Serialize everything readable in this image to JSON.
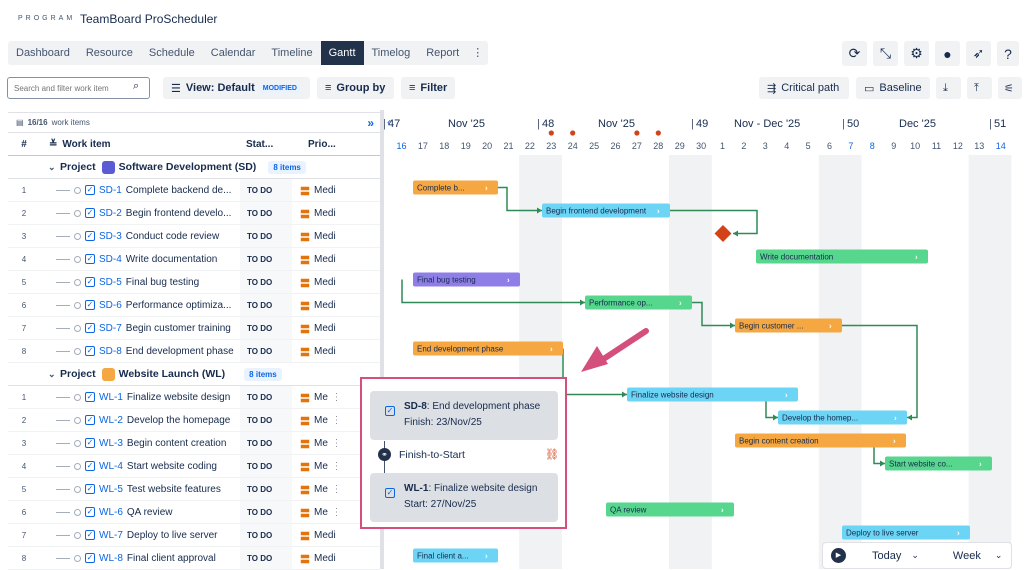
{
  "header": {
    "program_label": "PROGRAM",
    "app_title": "TeamBoard ProScheduler"
  },
  "tabs": [
    {
      "label": "Dashboard"
    },
    {
      "label": "Resource"
    },
    {
      "label": "Schedule"
    },
    {
      "label": "Calendar"
    },
    {
      "label": "Timeline"
    },
    {
      "label": "Gantt"
    },
    {
      "label": "Timelog"
    },
    {
      "label": "Report"
    }
  ],
  "tab_more": "⋮",
  "toolbar": {
    "search_placeholder": "Search and filter work item",
    "view_label": "View: Default",
    "modified": "MODIFIED",
    "group_by": "Group by",
    "filter": "Filter",
    "critical_path": "Critical path",
    "baseline": "Baseline"
  },
  "table": {
    "count": "16/16",
    "count_label": "work items",
    "col_num": "#",
    "col_item": "Work item",
    "col_status": "Stat...",
    "col_prio": "Prio...",
    "expand_glyph": "»"
  },
  "projects": [
    {
      "label": "Project",
      "name": "Software Development (SD)",
      "badge": "8 items",
      "items": [
        {
          "num": "1",
          "key": "SD-1",
          "title": "Complete backend de...",
          "status": "TO DO",
          "prio": "Medi"
        },
        {
          "num": "2",
          "key": "SD-2",
          "title": "Begin frontend develo...",
          "status": "TO DO",
          "prio": "Medi"
        },
        {
          "num": "3",
          "key": "SD-3",
          "title": "Conduct code review",
          "status": "TO DO",
          "prio": "Medi"
        },
        {
          "num": "4",
          "key": "SD-4",
          "title": "Write documentation",
          "status": "TO DO",
          "prio": "Medi"
        },
        {
          "num": "5",
          "key": "SD-5",
          "title": "Final bug testing",
          "status": "TO DO",
          "prio": "Medi"
        },
        {
          "num": "6",
          "key": "SD-6",
          "title": "Performance optimiza...",
          "status": "TO DO",
          "prio": "Medi"
        },
        {
          "num": "7",
          "key": "SD-7",
          "title": "Begin customer training",
          "status": "TO DO",
          "prio": "Medi"
        },
        {
          "num": "8",
          "key": "SD-8",
          "title": "End development phase",
          "status": "TO DO",
          "prio": "Medi"
        }
      ]
    },
    {
      "label": "Project",
      "name": "Website Launch (WL)",
      "badge": "8 items",
      "items": [
        {
          "num": "1",
          "key": "WL-1",
          "title": "Finalize website design",
          "status": "TO DO",
          "prio": "Me"
        },
        {
          "num": "2",
          "key": "WL-2",
          "title": "Develop the homepage",
          "status": "TO DO",
          "prio": "Me"
        },
        {
          "num": "3",
          "key": "WL-3",
          "title": "Begin content creation",
          "status": "TO DO",
          "prio": "Me"
        },
        {
          "num": "4",
          "key": "WL-4",
          "title": "Start website coding",
          "status": "TO DO",
          "prio": "Me"
        },
        {
          "num": "5",
          "key": "WL-5",
          "title": "Test website features",
          "status": "TO DO",
          "prio": "Me"
        },
        {
          "num": "6",
          "key": "WL-6",
          "title": "QA review",
          "status": "TO DO",
          "prio": "Me"
        },
        {
          "num": "7",
          "key": "WL-7",
          "title": "Deploy to live server",
          "status": "TO DO",
          "prio": "Medi"
        },
        {
          "num": "8",
          "key": "WL-8",
          "title": "Final client approval",
          "status": "TO DO",
          "prio": "Medi"
        }
      ]
    }
  ],
  "timeline": {
    "weeks": [
      {
        "label": "47"
      },
      {
        "label": "Nov '25"
      },
      {
        "label": "48"
      },
      {
        "label": "Nov '25"
      },
      {
        "label": "49"
      },
      {
        "label": "Nov - Dec '25"
      },
      {
        "label": "50"
      },
      {
        "label": "Dec '25"
      },
      {
        "label": "51"
      }
    ],
    "days": [
      "16",
      "17",
      "18",
      "19",
      "20",
      "21",
      "22",
      "23",
      "24",
      "25",
      "26",
      "27",
      "28",
      "29",
      "30",
      "1",
      "2",
      "3",
      "4",
      "5",
      "6",
      "7",
      "8",
      "9",
      "10",
      "11",
      "12",
      "13",
      "14"
    ],
    "back_glyph": "‹"
  },
  "bars": [
    {
      "label": "Complete b...",
      "color": "#f5a742"
    },
    {
      "label": "Begin frontend development",
      "color": "#6cd4f5"
    },
    {
      "label": "Write documentation",
      "color": "#57d68d"
    },
    {
      "label": "Final bug testing",
      "color": "#8f7ee7"
    },
    {
      "label": "Performance op...",
      "color": "#57d68d"
    },
    {
      "label": "Begin customer ...",
      "color": "#f5a742"
    },
    {
      "label": "End development phase",
      "color": "#f5a742"
    },
    {
      "label": "Finalize website design",
      "color": "#6cd4f5"
    },
    {
      "label": "Develop the homep...",
      "color": "#6cd4f5"
    },
    {
      "label": "Begin content creation",
      "color": "#f5a742"
    },
    {
      "label": "Start website co...",
      "color": "#57d68d"
    },
    {
      "label": "QA review",
      "color": "#57d68d"
    },
    {
      "label": "Deploy to live server",
      "color": "#6cd4f5"
    },
    {
      "label": "Final client a...",
      "color": "#6cd4f5"
    }
  ],
  "popup": {
    "from_key": "SD-8",
    "from_title": ": End development phase",
    "from_date": "Finish: 23/Nov/25",
    "link_type": "Finish-to-Start",
    "to_key": "WL-1",
    "to_title": ": Finalize website design",
    "to_date": "Start: 27/Nov/25"
  },
  "bottom": {
    "today": "Today",
    "scale": "Week"
  },
  "colors": {
    "accent": "#0c66e4",
    "highlight": "#d44f7b",
    "milestone": "#d3431a",
    "dark_tab": "#22324a"
  }
}
